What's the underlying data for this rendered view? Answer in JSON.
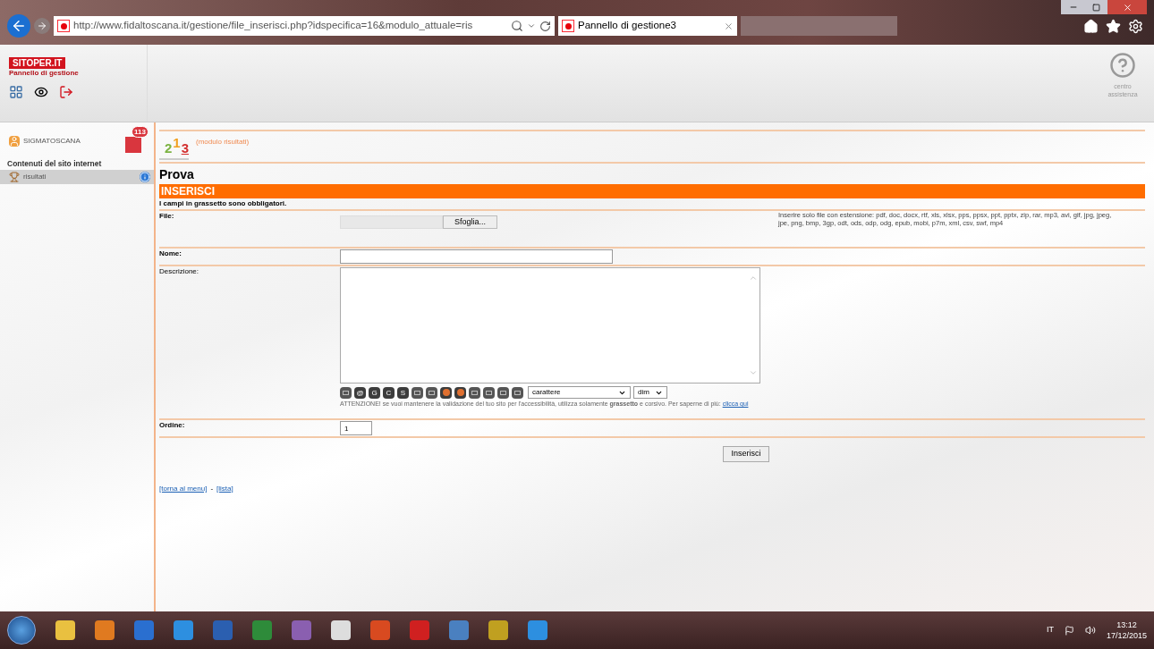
{
  "browser": {
    "url": "http://www.fidaltoscana.it/gestione/file_inserisci.php?idspecifica=16&modulo_attuale=ris",
    "tab_title": "Pannello di gestione3"
  },
  "app_header": {
    "logo_title": "SITOPER.IT",
    "logo_subtitle": "Pannello di gestione",
    "help_label": "centro assistenza"
  },
  "sidebar": {
    "site": "SIGMATOSCANA",
    "badge": "113",
    "section": "Contenuti del sito internet",
    "items": [
      {
        "label": "risultati",
        "selected": true
      }
    ]
  },
  "module": {
    "digits": [
      "2",
      "1",
      "3"
    ],
    "label": "(modulo risultati)"
  },
  "page_title": "Prova",
  "form_header": "INSERISCI",
  "note": "I campi in grassetto sono obbligatori.",
  "file_field": {
    "label": "File:",
    "button": "Sfoglia...",
    "hint": "Inserire solo file con estensione: pdf, doc, docx, rtf, xls, xlsx, pps, ppsx, ppt, pptx, zip, rar, mp3, avi, gif, jpg, jpeg, jpe, png, bmp, 3gp, odt, ods, odp, odg, epub, mobi, p7m, xml, csv, swf, mp4"
  },
  "name_field": {
    "label": "Nome:"
  },
  "description_field": {
    "label": "Descrizione:",
    "editor_buttons": [
      {
        "kind": "icon"
      },
      {
        "kind": "text",
        "label": "@"
      },
      {
        "kind": "text",
        "label": "G"
      },
      {
        "kind": "text",
        "label": "C"
      },
      {
        "kind": "text",
        "label": "S"
      },
      {
        "kind": "icon"
      },
      {
        "kind": "icon"
      },
      {
        "kind": "image"
      },
      {
        "kind": "image"
      },
      {
        "kind": "icon"
      },
      {
        "kind": "icon"
      },
      {
        "kind": "icon"
      },
      {
        "kind": "icon"
      }
    ],
    "font_select": "carattere",
    "size_select": "dim",
    "warning": "ATTENZIONE! se vuoi mantenere la validazione del tuo sito per l'accessibilità, utilizza solamente **grassetto** e corsivo. Per saperne di più:",
    "warning_link": "clicca qui"
  },
  "order_field": {
    "label": "Ordine:",
    "value": "1"
  },
  "submit": "Inserisci",
  "footer_links": [
    "[torna al menu]",
    "[lista]"
  ],
  "footer_separator": "-",
  "taskbar": {
    "language": "IT",
    "time": "13:12",
    "date": "17/12/2015"
  }
}
